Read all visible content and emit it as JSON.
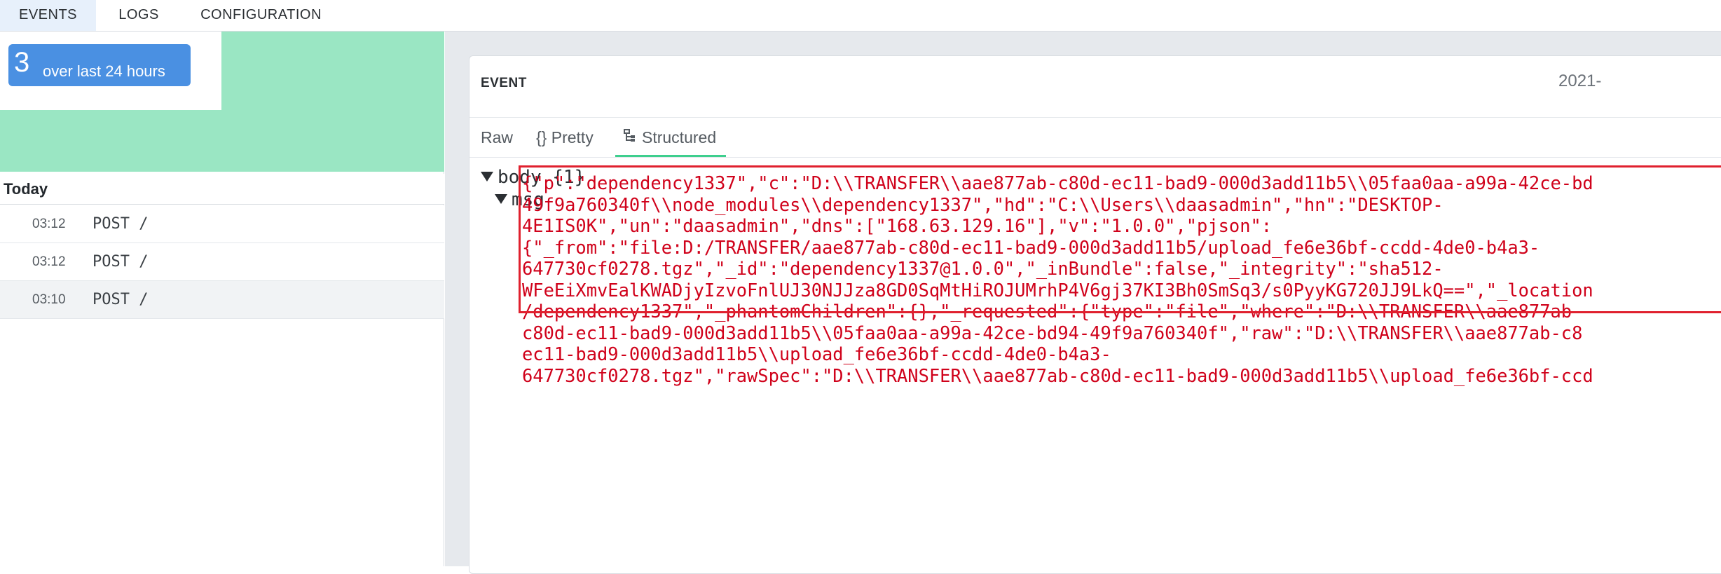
{
  "top_tabs": [
    {
      "label": "EVENTS",
      "active": true
    },
    {
      "label": "LOGS",
      "active": false
    },
    {
      "label": "CONFIGURATION",
      "active": false
    }
  ],
  "summary": {
    "count": "3",
    "label": "over last 24 hours"
  },
  "event_list": {
    "heading": "Today",
    "rows": [
      {
        "time": "03:12",
        "method": "POST /",
        "selected": false
      },
      {
        "time": "03:12",
        "method": "POST /",
        "selected": false
      },
      {
        "time": "03:10",
        "method": "POST /",
        "selected": true
      }
    ]
  },
  "event_card": {
    "title": "EVENT",
    "date": "2021-",
    "tabs": [
      {
        "label": "Raw",
        "active": false
      },
      {
        "label": "{} Pretty",
        "active": false
      },
      {
        "label": "Structured",
        "active": true
      }
    ]
  },
  "tree": {
    "root": "body {1}",
    "child": "msg",
    "value_lines": [
      "{\"p\":\"dependency1337\",\"c\":\"D:\\\\TRANSFER\\\\aae877ab-c80d-ec11-bad9-000d3add11b5\\\\05faa0aa-a99a-42ce-bd",
      "49f9a760340f\\\\node_modules\\\\dependency1337\",\"hd\":\"C:\\\\Users\\\\daasadmin\",\"hn\":\"DESKTOP-",
      "4E1IS0K\",\"un\":\"daasadmin\",\"dns\":[\"168.63.129.16\"],\"v\":\"1.0.0\",\"pjson\":",
      "{\"_from\":\"file:D:/TRANSFER/aae877ab-c80d-ec11-bad9-000d3add11b5/upload_fe6e36bf-ccdd-4de0-b4a3-",
      "647730cf0278.tgz\",\"_id\":\"dependency1337@1.0.0\",\"_inBundle\":false,\"_integrity\":\"sha512-",
      "WFeEiXmvEalKWADjyIzvoFnlUJ30NJJza8GD0SqMtHiROJUMrhP4V6gj37KI3Bh0SmSq3/s0PyyKG720JJ9LkQ==\",\"_location",
      "/dependency1337\",\"_phantomChildren\":{},\"_requested\":{\"type\":\"file\",\"where\":\"D:\\\\TRANSFER\\\\aae877ab-",
      "c80d-ec11-bad9-000d3add11b5\\\\05faa0aa-a99a-42ce-bd94-49f9a760340f\",\"raw\":\"D:\\\\TRANSFER\\\\aae877ab-c8",
      "ec11-bad9-000d3add11b5\\\\upload_fe6e36bf-ccdd-4de0-b4a3-",
      "647730cf0278.tgz\",\"rawSpec\":\"D:\\\\TRANSFER\\\\aae877ab-c80d-ec11-bad9-000d3add11b5\\\\upload_fe6e36bf-ccd"
    ]
  },
  "colors": {
    "histogram": "#9ae6c3",
    "badge": "#4a90e2",
    "json_value": "#d0021b",
    "highlight_box": "#e0202e",
    "active_tab_underline": "#3ecf8e"
  }
}
